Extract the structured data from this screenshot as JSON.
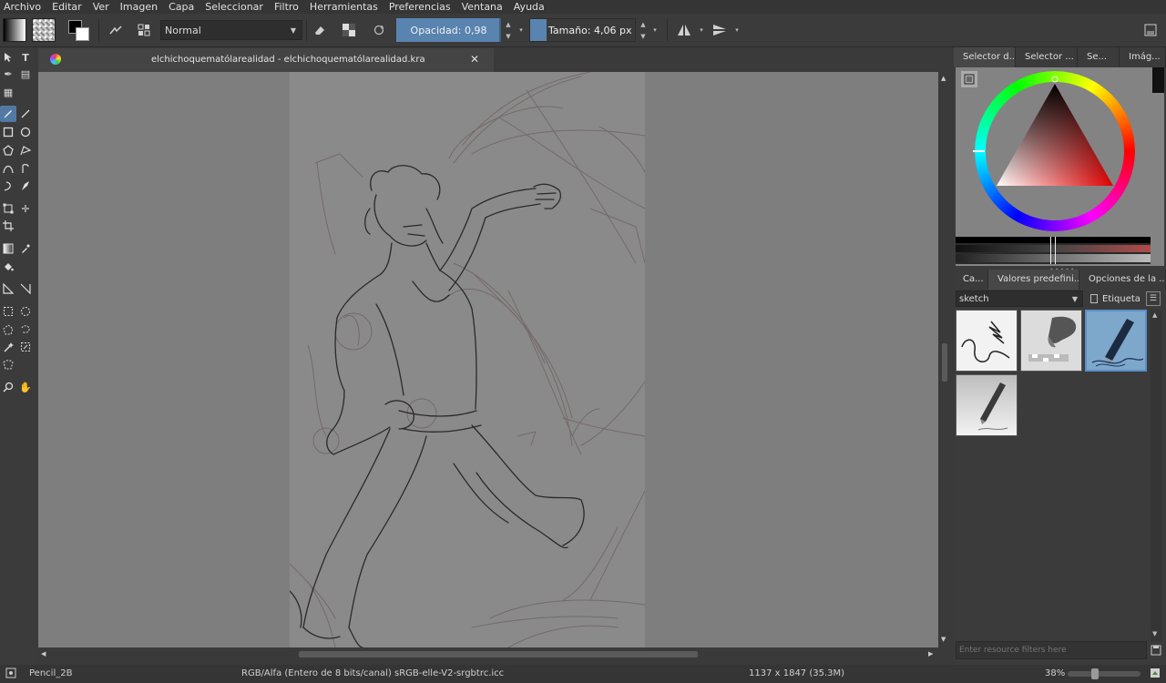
{
  "menubar": {
    "items": [
      {
        "label": "Archivo"
      },
      {
        "label": "Editar"
      },
      {
        "label": "Ver"
      },
      {
        "label": "Imagen"
      },
      {
        "label": "Capa"
      },
      {
        "label": "Seleccionar"
      },
      {
        "label": "Filtro"
      },
      {
        "label": "Herramientas"
      },
      {
        "label": "Preferencias"
      },
      {
        "label": "Ventana"
      },
      {
        "label": "Ayuda"
      }
    ]
  },
  "toolbar": {
    "blend_mode": "Normal",
    "opacity_label": "Opacidad:",
    "opacity_value": "0,98",
    "opacity_fraction": 0.98,
    "size_label": "Tamaño:",
    "size_value": "4,06 px"
  },
  "document": {
    "tab_title": "elchichoquematólarealidad - elchichoquematólarealidad.kra"
  },
  "dock": {
    "top_tabs": [
      "Selector d...",
      "Selector ...",
      "Se...",
      "Imág..."
    ],
    "preset_tabs": [
      "Ca...",
      "Valores predefini...",
      "Opciones de la ..."
    ],
    "tag_value": "sketch",
    "etiqueta_label": "Etiqueta",
    "filter_placeholder": "Enter resource filters here"
  },
  "status": {
    "brush_name": "Pencil_2B",
    "color_info": "RGB/Alfa (Entero de 8 bits/canal)  sRGB-elle-V2-srgbtrc.icc",
    "dimensions": "1137 x 1847 (35.3M)",
    "zoom": "38%"
  },
  "colors": {
    "accent": "#5a84b0",
    "selected_preset": "#5b8fc4"
  }
}
